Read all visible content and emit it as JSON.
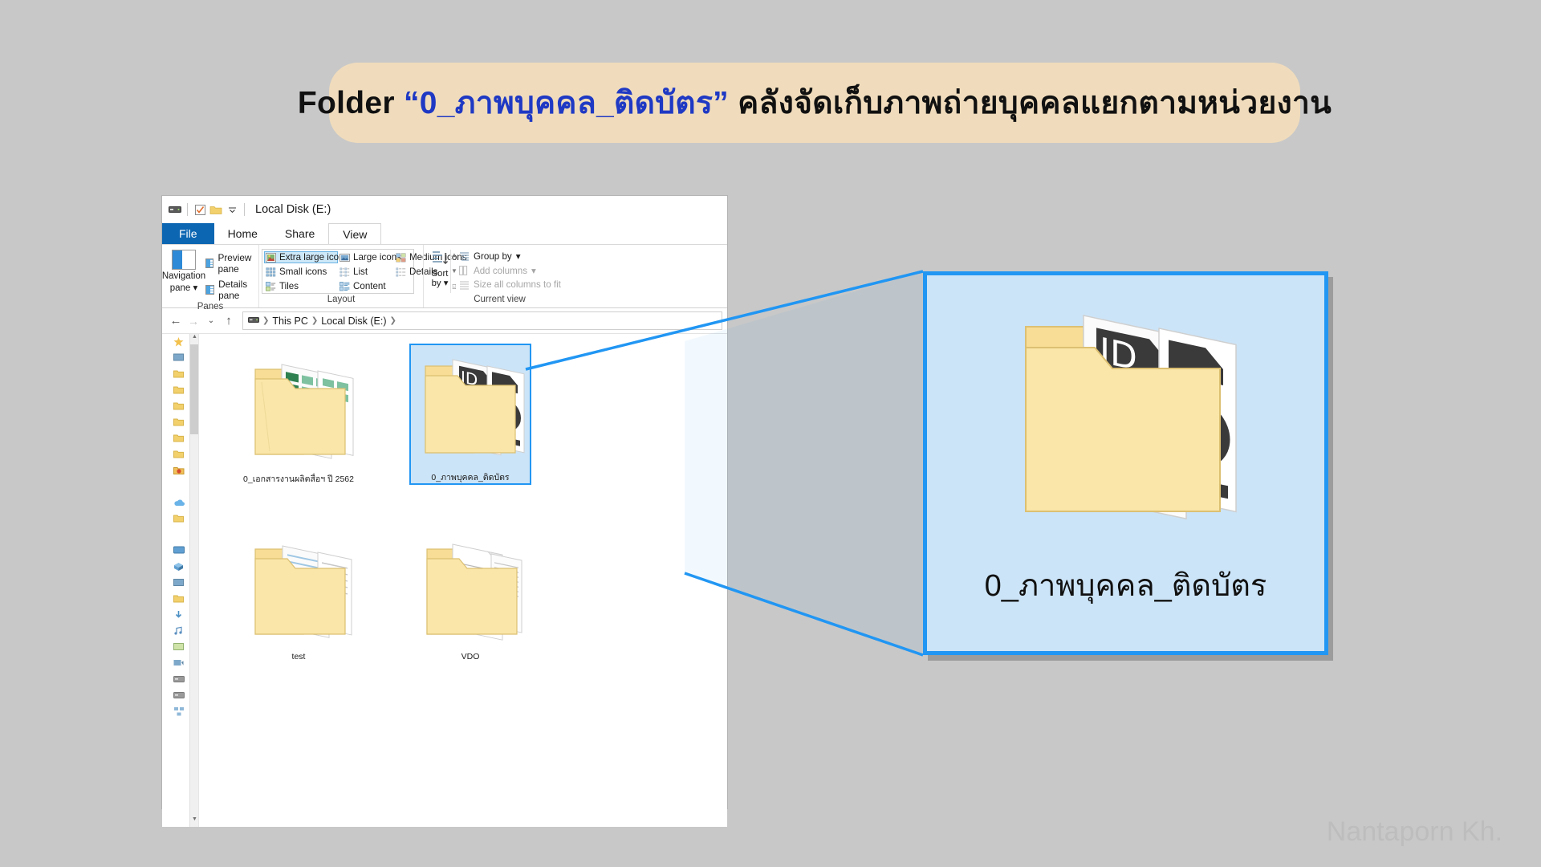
{
  "banner": {
    "prefix": "Folder ",
    "quoted_folder": "“0_ภาพบุคคล_ติดบัตร”",
    "description": " คลังจัดเก็บภาพถ่ายบุคคลแยกตามหน่วยงาน",
    "background_color": "#f0dcbc",
    "accent_color": "#1f39c4"
  },
  "explorer": {
    "titlebar": {
      "title": "Local Disk (E:)",
      "quick_access": [
        "drive-icon",
        "properties-icon",
        "new-folder-icon",
        "customize-chevron-icon"
      ]
    },
    "tabs": [
      {
        "label": "File",
        "state": "file-menu"
      },
      {
        "label": "Home",
        "state": "normal"
      },
      {
        "label": "Share",
        "state": "normal"
      },
      {
        "label": "View",
        "state": "active"
      }
    ],
    "ribbon": {
      "groups": [
        {
          "label": "Panes",
          "navigation_pane": {
            "line1": "Navigation",
            "line2": "pane"
          },
          "items": [
            {
              "label": "Preview pane"
            },
            {
              "label": "Details pane"
            }
          ]
        },
        {
          "label": "Layout",
          "items": [
            {
              "label": "Extra large icons",
              "selected": true
            },
            {
              "label": "Large icons",
              "selected": false
            },
            {
              "label": "Medium icons",
              "selected": false
            },
            {
              "label": "Small icons",
              "selected": false
            },
            {
              "label": "List",
              "selected": false
            },
            {
              "label": "Details",
              "selected": false
            },
            {
              "label": "Tiles",
              "selected": false
            },
            {
              "label": "Content",
              "selected": false
            }
          ]
        },
        {
          "label": "Current view",
          "sort_by": {
            "line1": "Sort",
            "line2": "by"
          },
          "items": [
            {
              "label": "Group by",
              "dimmed": false
            },
            {
              "label": "Add columns",
              "dimmed": true
            },
            {
              "label": "Size all columns to fit",
              "dimmed": true
            }
          ]
        }
      ]
    },
    "addressbar": {
      "back": "←",
      "forward": "→",
      "history": "⌄",
      "up": "↑",
      "crumbs": [
        "This PC",
        "Local Disk (E:)"
      ]
    },
    "files": [
      {
        "name": "0_เอกสารงานผลิตสื่อฯ ปี 2562",
        "type": "folder-spreadsheet",
        "selected": false
      },
      {
        "name": "0_ภาพบุคคล_ติดบัตร",
        "type": "folder-photos",
        "selected": true
      },
      {
        "name": "test",
        "type": "folder-documents",
        "selected": false
      },
      {
        "name": "VDO",
        "type": "folder-text",
        "selected": false
      }
    ]
  },
  "callout": {
    "folder_name": "0_ภาพบุคคล_ติดบัตร",
    "border_color": "#2196f3",
    "fill_color": "#cce4f7"
  },
  "watermark": {
    "text": "Nantaporn Kh."
  }
}
